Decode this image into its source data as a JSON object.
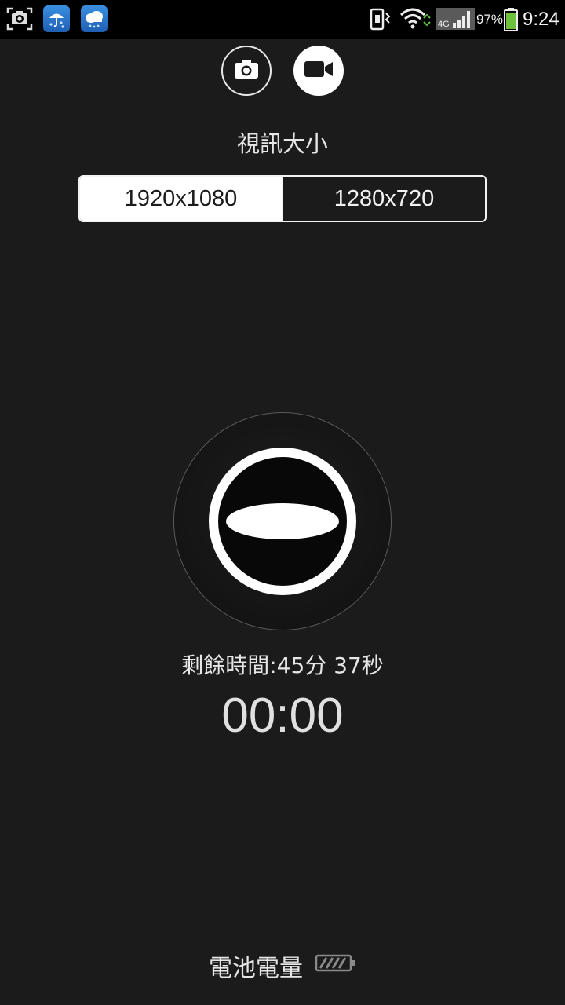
{
  "status_bar": {
    "left_icons": [
      "screenshot-icon",
      "weather-rain-icon",
      "weather-cloud-rain-icon"
    ],
    "right_icons": [
      "vibrate-icon",
      "wifi-icon",
      "cell-signal-4g-icon",
      "battery-icon"
    ],
    "network_label": "4G",
    "battery_percent": "97%",
    "time": "9:24"
  },
  "mode_toggle": {
    "photo_icon": "camera-icon",
    "video_icon": "video-camera-icon",
    "selected": "video"
  },
  "video_size": {
    "title": "視訊大小",
    "options": [
      "1920x1080",
      "1280x720"
    ],
    "selected_index": 0
  },
  "recorder": {
    "record_button_icon": "record-icon",
    "remaining_time": "剩餘時間:45分  37秒",
    "elapsed": "00:00"
  },
  "footer": {
    "battery_label": "電池電量",
    "battery_icon": "battery-low-icon"
  },
  "colors": {
    "background": "#1b1b1b",
    "status_bar": "#000000",
    "foreground": "#ffffff"
  }
}
